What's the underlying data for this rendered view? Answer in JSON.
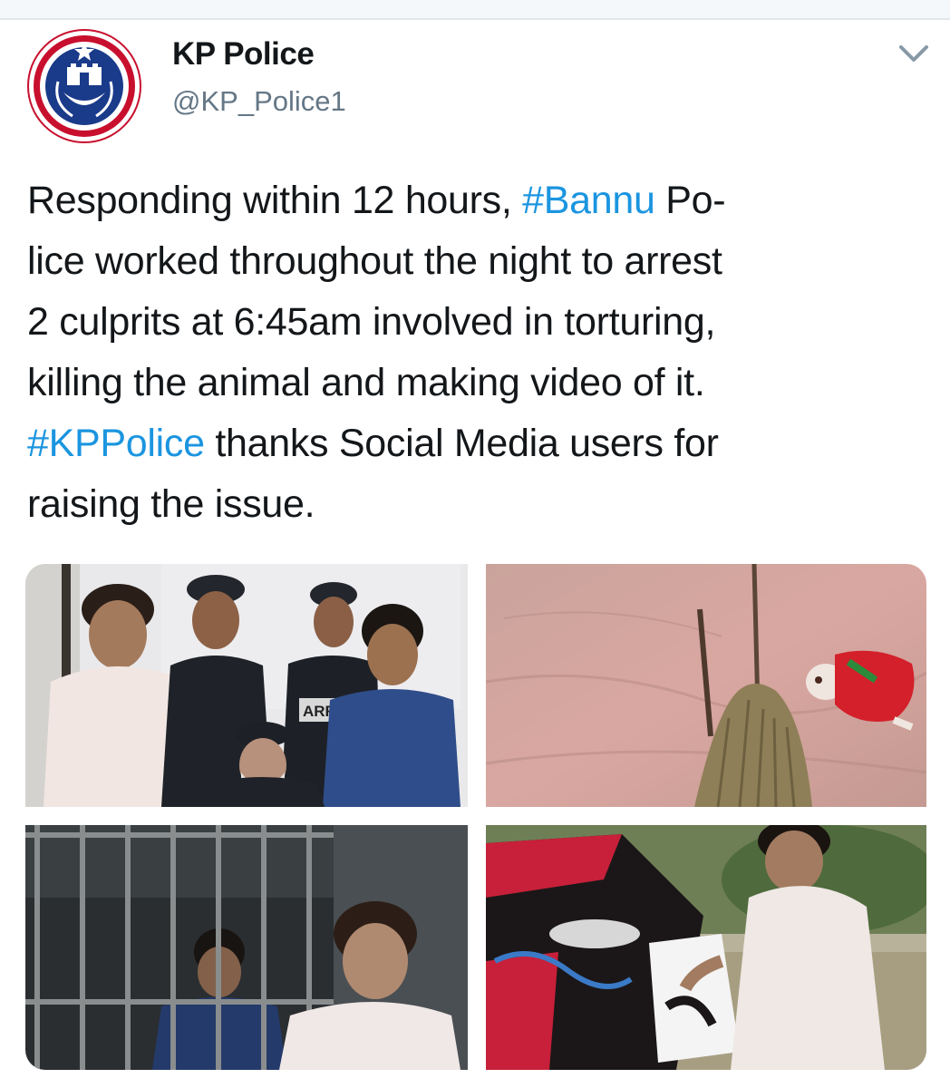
{
  "account": {
    "display_name": "KP Police",
    "handle": "@KP_Police1",
    "avatar_icon": "kp-police-badge-icon"
  },
  "menu": {
    "icon": "chevron-down-icon"
  },
  "tweet": {
    "lines": [
      {
        "parts": [
          {
            "text": "Responding within 12 hours, ",
            "hashtag": false
          },
          {
            "text": "#Bannu",
            "hashtag": true
          },
          {
            "text": " Po-",
            "hashtag": false
          }
        ]
      },
      {
        "parts": [
          {
            "text": "lice worked throughout the night to arrest",
            "hashtag": false
          }
        ]
      },
      {
        "parts": [
          {
            "text": "2 culprits at 6:45am involved in torturing,",
            "hashtag": false
          }
        ]
      },
      {
        "parts": [
          {
            "text": "killing the animal and making video of it.",
            "hashtag": false
          }
        ]
      },
      {
        "parts": [
          {
            "text": "#KPPolice",
            "hashtag": true
          },
          {
            "text": " thanks Social Media users for",
            "hashtag": false
          }
        ]
      },
      {
        "parts": [
          {
            "text": "raising the issue.",
            "hashtag": false
          }
        ]
      }
    ]
  },
  "media": [
    {
      "name": "photo-arrested-suspects-with-police",
      "sign_text": "ARR"
    },
    {
      "name": "photo-video-still-animal-in-field"
    },
    {
      "name": "photo-suspects-behind-bars"
    },
    {
      "name": "photo-video-still-man-with-flag"
    }
  ],
  "colors": {
    "hashtag": "#1b95e0",
    "text": "#14171a",
    "handle": "#657786",
    "badge_blue": "#1a3a8a",
    "badge_red": "#c8102e"
  }
}
